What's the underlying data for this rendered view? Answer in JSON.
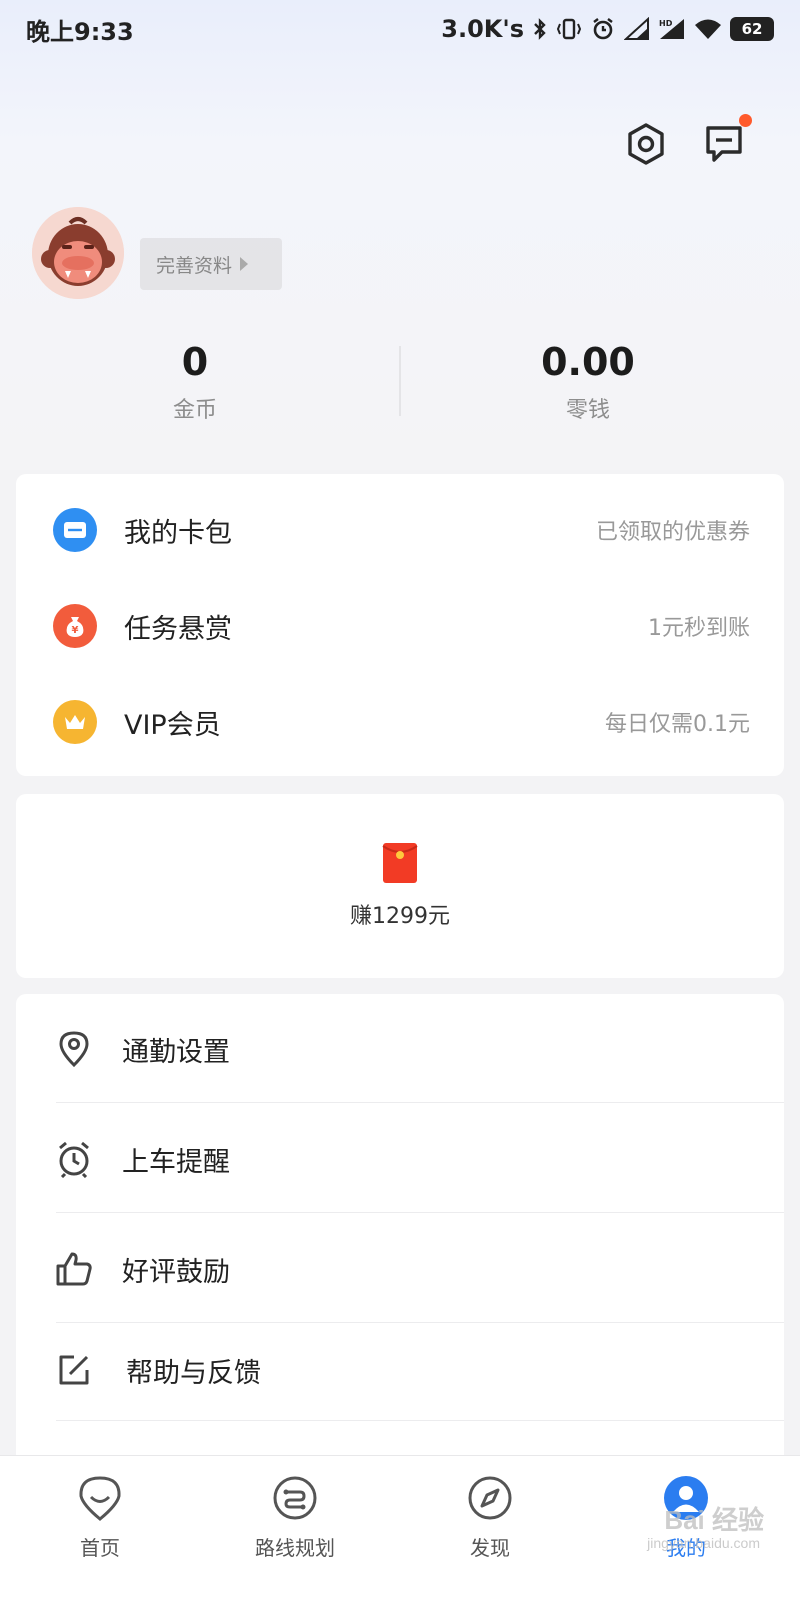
{
  "status_bar": {
    "time": "晚上9:33",
    "network_speed": "3.0K's",
    "battery": "62",
    "icons": [
      "bluetooth-icon",
      "vibrate-icon",
      "alarm-icon",
      "signal-icon",
      "hd-signal-icon",
      "wifi-icon",
      "battery-icon"
    ]
  },
  "header": {
    "icons": [
      "settings-icon",
      "message-icon"
    ],
    "notification_dot_color": "#ff5a2c"
  },
  "profile": {
    "username": "　",
    "complete_profile_label": "完善资料"
  },
  "stats": [
    {
      "value": "0",
      "label": "金币"
    },
    {
      "value": "0.00",
      "label": "零钱"
    }
  ],
  "wallet_menu": [
    {
      "label": "我的卡包",
      "hint": "已领取的优惠券",
      "icon": "card-wallet-icon",
      "color": "#2f8ff2"
    },
    {
      "label": "任务悬赏",
      "hint": "1元秒到账",
      "icon": "money-bag-icon",
      "color": "#f25c3c"
    },
    {
      "label": "VIP会员",
      "hint": "每日仅需0.1元",
      "icon": "crown-icon",
      "color": "#f6b531"
    }
  ],
  "promo": {
    "label": "赚1299元",
    "icon": "red-envelope-icon"
  },
  "settings_menu": [
    {
      "label": "通勤设置",
      "icon": "location-pin-icon"
    },
    {
      "label": "上车提醒",
      "icon": "alarm-clock-icon"
    },
    {
      "label": "好评鼓励",
      "icon": "thumbs-up-icon"
    },
    {
      "label": "帮助与反馈",
      "icon": "edit-icon"
    }
  ],
  "bottom_nav": [
    {
      "label": "首页",
      "icon": "home-icon"
    },
    {
      "label": "路线规划",
      "icon": "route-icon"
    },
    {
      "label": "发现",
      "icon": "compass-icon"
    },
    {
      "label": "我的",
      "icon": "user-icon",
      "active": true
    }
  ],
  "watermark": {
    "text": "Bai 经验",
    "sub": "jingyan.baidu.com"
  }
}
